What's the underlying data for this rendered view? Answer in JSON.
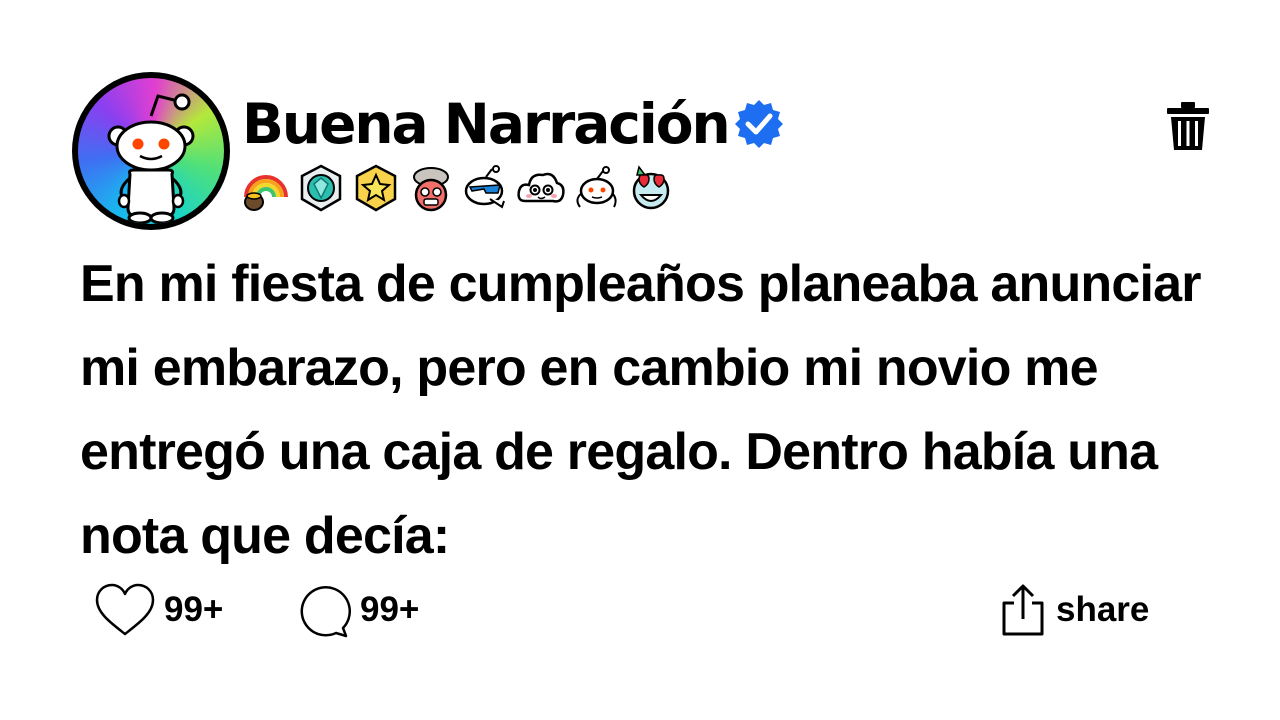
{
  "post": {
    "author": "Buena Narración",
    "verified": true,
    "text": "En mi fiesta de cumpleaños planeaba anunciar mi embarazo, pero en cambio mi novio me entregó una caja de regalo. Dentro había una nota que decía:"
  },
  "awards": [
    "rainbow-pot-award-icon",
    "diamond-gem-award-icon",
    "gold-star-award-icon",
    "mind-blown-award-icon",
    "cool-snoo-award-icon",
    "cloud-face-award-icon",
    "snoo-shrug-award-icon",
    "heart-eyes-award-icon"
  ],
  "actions": {
    "likes": "99+",
    "comments": "99+",
    "share_label": "share"
  },
  "colors": {
    "verified": "#1d6ef0",
    "text": "#000000",
    "background": "#ffffff",
    "snoo_eyes": "#ff4500"
  }
}
